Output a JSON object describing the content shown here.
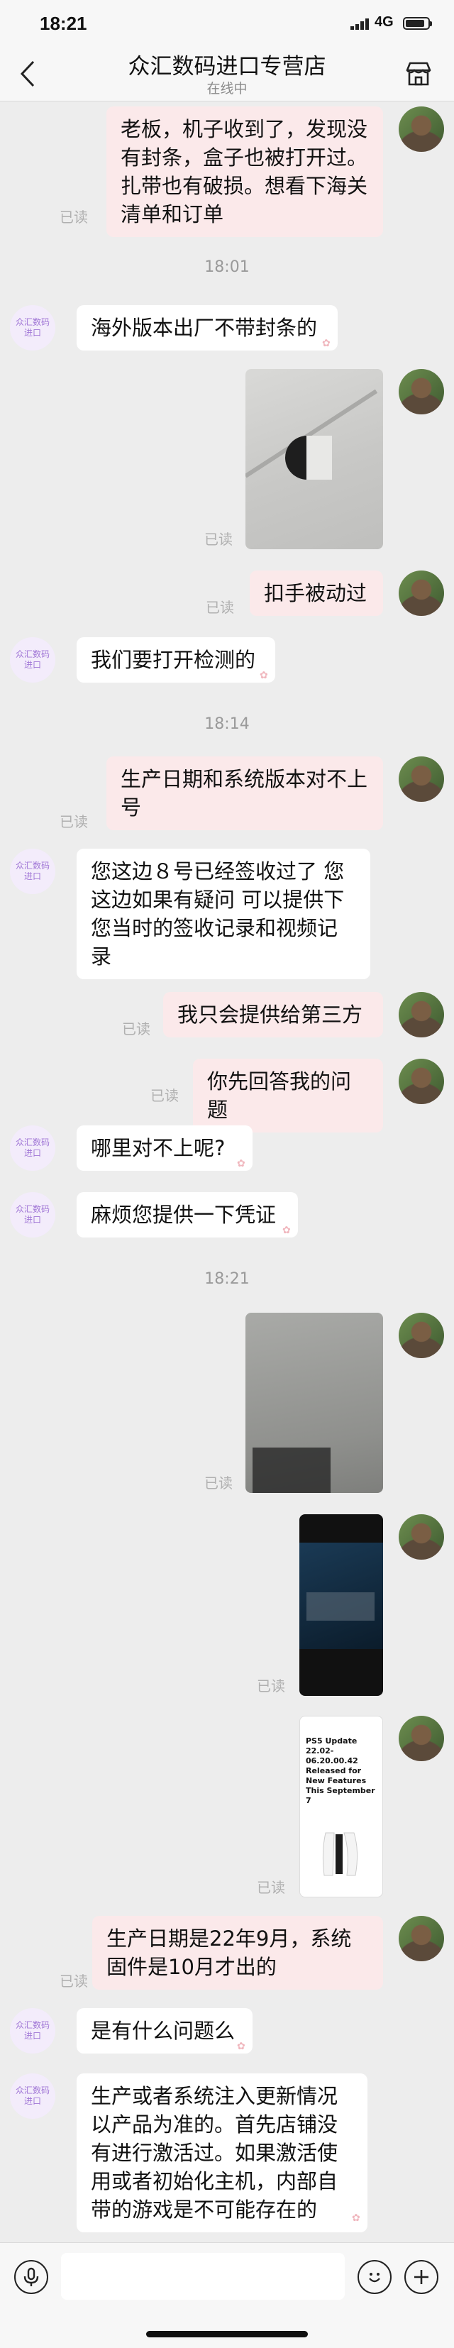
{
  "status_bar": {
    "time": "18:21",
    "network": "4G"
  },
  "header": {
    "title": "众汇数码进口专营店",
    "subtitle": "在线中"
  },
  "shop_avatar_text": [
    "众汇数码",
    "进口"
  ],
  "read_label": "已读",
  "timestamps": [
    "18:01",
    "18:14",
    "18:21"
  ],
  "messages": [
    {
      "from": "user",
      "text": "老板，机子收到了，发现没有封条，盒子也被打开过。扎带也有破损。想看下海关清单和订单"
    },
    {
      "from": "shop",
      "text": "海外版本出厂不带封条的"
    },
    {
      "from": "user",
      "type": "image",
      "image": "photo-box-corner"
    },
    {
      "from": "user",
      "text": "扣手被动过"
    },
    {
      "from": "shop",
      "text": "我们要打开检测的"
    },
    {
      "from": "user",
      "text": "生产日期和系统版本对不上号"
    },
    {
      "from": "shop",
      "text": "您这边８号已经签收过了 您这边如果有疑问  可以提供下您当时的签收记录和视频记录"
    },
    {
      "from": "user",
      "text": "我只会提供给第三方"
    },
    {
      "from": "user",
      "text": "你先回答我的问题"
    },
    {
      "from": "shop",
      "text": "哪里对不上呢?"
    },
    {
      "from": "shop",
      "text": "麻烦您提供一下凭证"
    },
    {
      "from": "user",
      "type": "image",
      "image": "photo-console-panel"
    },
    {
      "from": "user",
      "type": "image",
      "image": "photo-screen"
    },
    {
      "from": "user",
      "type": "image",
      "image": "screenshot-ps5-update",
      "caption": "PS5 Update 22.02-06.20.00.42 Released for New Features This September 7"
    },
    {
      "from": "user",
      "text": "生产日期是22年9月，系统固件是10月才出的"
    },
    {
      "from": "shop",
      "text": "是有什么问题么"
    },
    {
      "from": "shop",
      "text": "生产或者系统注入更新情况以产品为准的。首先店铺没有进行激活过。如果激活使用或者初始化主机，内部自带的游戏是不可能存在的"
    }
  ],
  "icons": {
    "back": "chevron-left-icon",
    "shop": "shop-icon",
    "mic": "voice-icon",
    "emoji": "emoji-icon",
    "plus": "plus-icon"
  }
}
